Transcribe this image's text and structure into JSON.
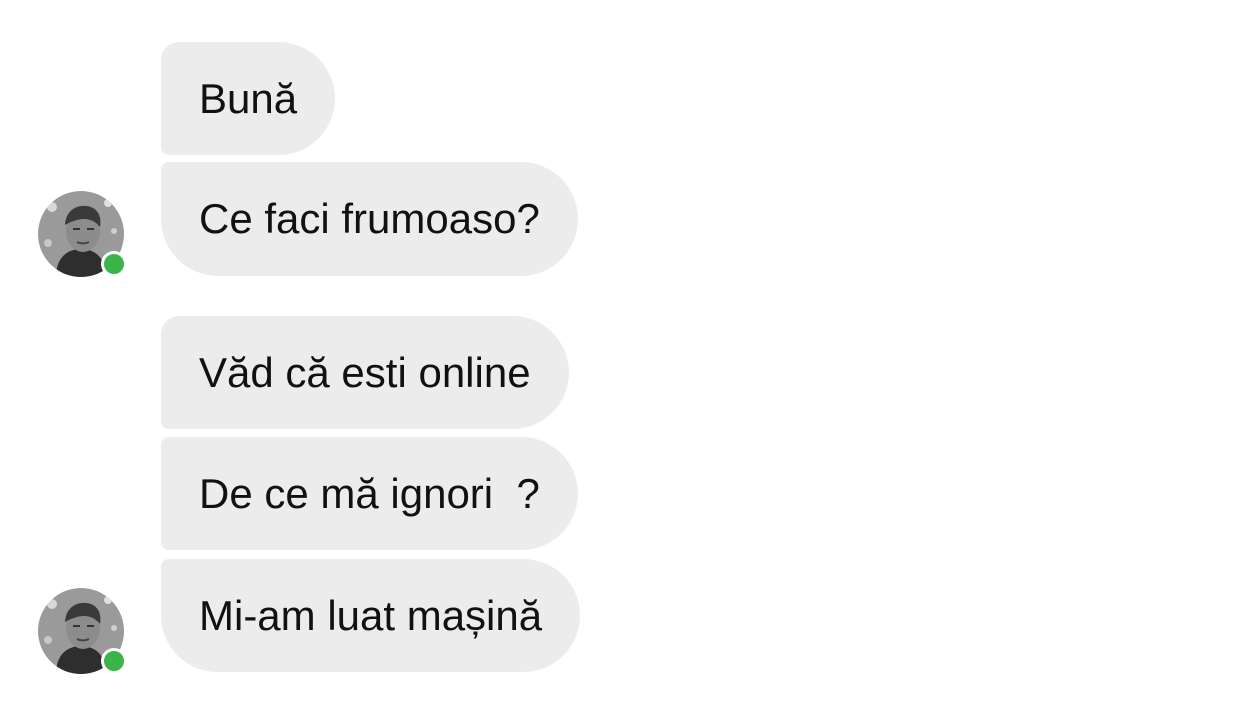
{
  "messages": [
    {
      "text": "Bună"
    },
    {
      "text": "Ce faci frumoaso?"
    },
    {
      "text": "Văd că esti online"
    },
    {
      "text": "De ce mă ignori  ?"
    },
    {
      "text": "Mi-am luat mașină"
    }
  ],
  "sender": {
    "avatar_icon": "profile-photo-icon",
    "status": "online",
    "status_color": "#3bb54a"
  },
  "colors": {
    "bubble_bg": "#ececec",
    "text": "#111111",
    "background": "#ffffff"
  }
}
